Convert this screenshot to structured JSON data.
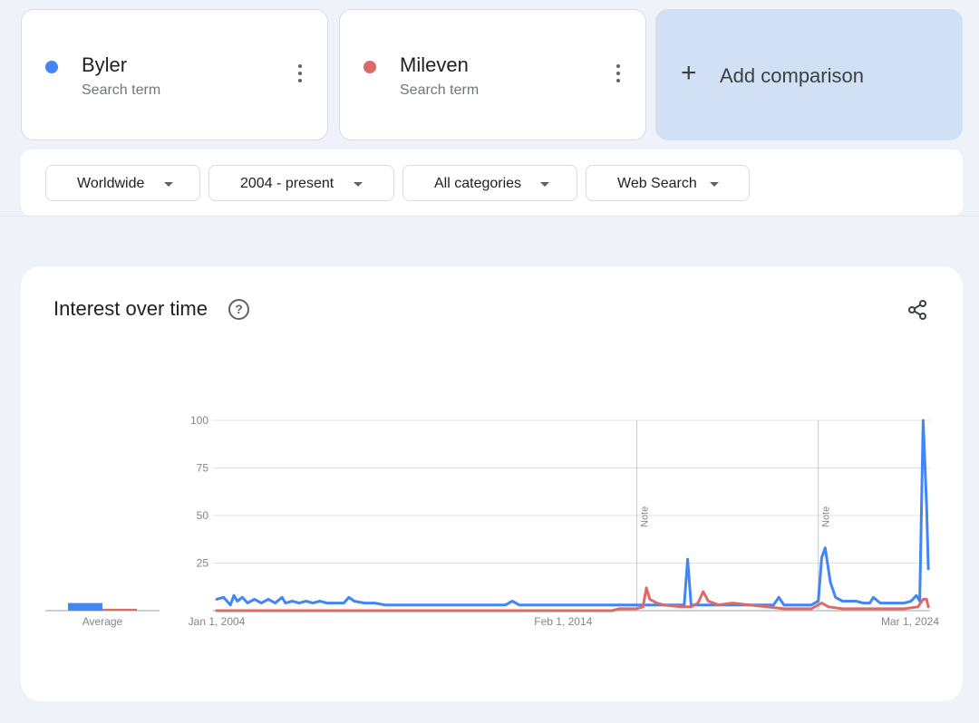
{
  "terms": [
    {
      "name": "Byler",
      "subtitle": "Search term",
      "color": "#4285f4"
    },
    {
      "name": "Mileven",
      "subtitle": "Search term",
      "color": "#db6b66"
    }
  ],
  "add_comparison": {
    "icon": "+",
    "label": "Add comparison"
  },
  "filters": {
    "region": "Worldwide",
    "time_range": "2004 - present",
    "category": "All categories",
    "search_type": "Web Search"
  },
  "chart_card": {
    "title": "Interest over time",
    "help_icon": "?"
  },
  "chart_data": {
    "type": "line",
    "title": "Interest over time",
    "ylim": [
      0,
      100
    ],
    "y_ticks": [
      "100",
      "75",
      "50",
      "25"
    ],
    "y_tick_values": [
      100,
      75,
      50,
      25
    ],
    "x_tick_labels": [
      "Jan 1, 2004",
      "Feb 1, 2014",
      "Mar 1, 2024"
    ],
    "x_tick_years": [
      2004.0,
      2014.08,
      2024.17
    ],
    "xlim": [
      2004.0,
      2024.75
    ],
    "grid": true,
    "notes": [
      {
        "label": "Note",
        "year": 2016.22
      },
      {
        "label": "Note",
        "year": 2021.5
      }
    ],
    "average": {
      "label": "Average",
      "values": [
        4,
        1
      ]
    },
    "series": [
      {
        "name": "Byler",
        "color": "#4285f4",
        "points": [
          [
            2004.0,
            6
          ],
          [
            2004.2,
            7
          ],
          [
            2004.4,
            3
          ],
          [
            2004.5,
            8
          ],
          [
            2004.6,
            5
          ],
          [
            2004.75,
            7
          ],
          [
            2004.9,
            4
          ],
          [
            2005.1,
            6
          ],
          [
            2005.3,
            4
          ],
          [
            2005.5,
            6
          ],
          [
            2005.7,
            4
          ],
          [
            2005.9,
            7
          ],
          [
            2006.0,
            4
          ],
          [
            2006.2,
            5
          ],
          [
            2006.4,
            4
          ],
          [
            2006.6,
            5
          ],
          [
            2006.8,
            4
          ],
          [
            2007.0,
            5
          ],
          [
            2007.2,
            4
          ],
          [
            2007.5,
            4
          ],
          [
            2007.7,
            4
          ],
          [
            2007.85,
            7
          ],
          [
            2008.0,
            5
          ],
          [
            2008.3,
            4
          ],
          [
            2008.6,
            4
          ],
          [
            2008.9,
            3
          ],
          [
            2009.2,
            3
          ],
          [
            2009.6,
            3
          ],
          [
            2010.0,
            3
          ],
          [
            2010.5,
            3
          ],
          [
            2011.0,
            3
          ],
          [
            2011.5,
            3
          ],
          [
            2012.0,
            3
          ],
          [
            2012.4,
            3
          ],
          [
            2012.6,
            5
          ],
          [
            2012.8,
            3
          ],
          [
            2013.2,
            3
          ],
          [
            2013.6,
            3
          ],
          [
            2014.0,
            3
          ],
          [
            2014.5,
            3
          ],
          [
            2015.0,
            3
          ],
          [
            2015.5,
            3
          ],
          [
            2016.0,
            3
          ],
          [
            2016.5,
            3
          ],
          [
            2017.0,
            3
          ],
          [
            2017.4,
            3
          ],
          [
            2017.6,
            3
          ],
          [
            2017.7,
            27
          ],
          [
            2017.8,
            3
          ],
          [
            2018.2,
            3
          ],
          [
            2018.8,
            3
          ],
          [
            2019.4,
            3
          ],
          [
            2019.8,
            3
          ],
          [
            2020.0,
            3
          ],
          [
            2020.2,
            3
          ],
          [
            2020.35,
            7
          ],
          [
            2020.5,
            3
          ],
          [
            2021.0,
            3
          ],
          [
            2021.3,
            3
          ],
          [
            2021.5,
            5
          ],
          [
            2021.6,
            28
          ],
          [
            2021.7,
            33
          ],
          [
            2021.85,
            15
          ],
          [
            2022.0,
            7
          ],
          [
            2022.2,
            5
          ],
          [
            2022.4,
            5
          ],
          [
            2022.6,
            5
          ],
          [
            2022.8,
            4
          ],
          [
            2023.0,
            4
          ],
          [
            2023.1,
            7
          ],
          [
            2023.3,
            4
          ],
          [
            2023.6,
            4
          ],
          [
            2023.8,
            4
          ],
          [
            2024.0,
            4
          ],
          [
            2024.2,
            5
          ],
          [
            2024.35,
            8
          ],
          [
            2024.45,
            5
          ],
          [
            2024.55,
            100
          ],
          [
            2024.65,
            55
          ],
          [
            2024.7,
            22
          ]
        ]
      },
      {
        "name": "Mileven",
        "color": "#db6b66",
        "points": [
          [
            2004.0,
            0
          ],
          [
            2005.0,
            0
          ],
          [
            2006.0,
            0
          ],
          [
            2007.0,
            0
          ],
          [
            2008.0,
            0
          ],
          [
            2009.0,
            0
          ],
          [
            2010.0,
            0
          ],
          [
            2011.0,
            0
          ],
          [
            2012.0,
            0
          ],
          [
            2013.0,
            0
          ],
          [
            2014.0,
            0
          ],
          [
            2015.0,
            0
          ],
          [
            2015.5,
            0
          ],
          [
            2015.7,
            1
          ],
          [
            2016.2,
            1
          ],
          [
            2016.4,
            2
          ],
          [
            2016.5,
            12
          ],
          [
            2016.6,
            6
          ],
          [
            2016.8,
            4
          ],
          [
            2017.0,
            3
          ],
          [
            2017.5,
            2
          ],
          [
            2017.8,
            2
          ],
          [
            2018.0,
            4
          ],
          [
            2018.15,
            10
          ],
          [
            2018.3,
            5
          ],
          [
            2018.6,
            3
          ],
          [
            2019.0,
            4
          ],
          [
            2019.5,
            3
          ],
          [
            2020.0,
            2
          ],
          [
            2020.5,
            1
          ],
          [
            2021.0,
            1
          ],
          [
            2021.3,
            1
          ],
          [
            2021.6,
            4
          ],
          [
            2021.8,
            2
          ],
          [
            2022.2,
            1
          ],
          [
            2022.6,
            1
          ],
          [
            2023.0,
            1
          ],
          [
            2023.5,
            1
          ],
          [
            2024.0,
            1
          ],
          [
            2024.4,
            2
          ],
          [
            2024.55,
            6
          ],
          [
            2024.65,
            6
          ],
          [
            2024.7,
            2
          ]
        ]
      }
    ]
  }
}
